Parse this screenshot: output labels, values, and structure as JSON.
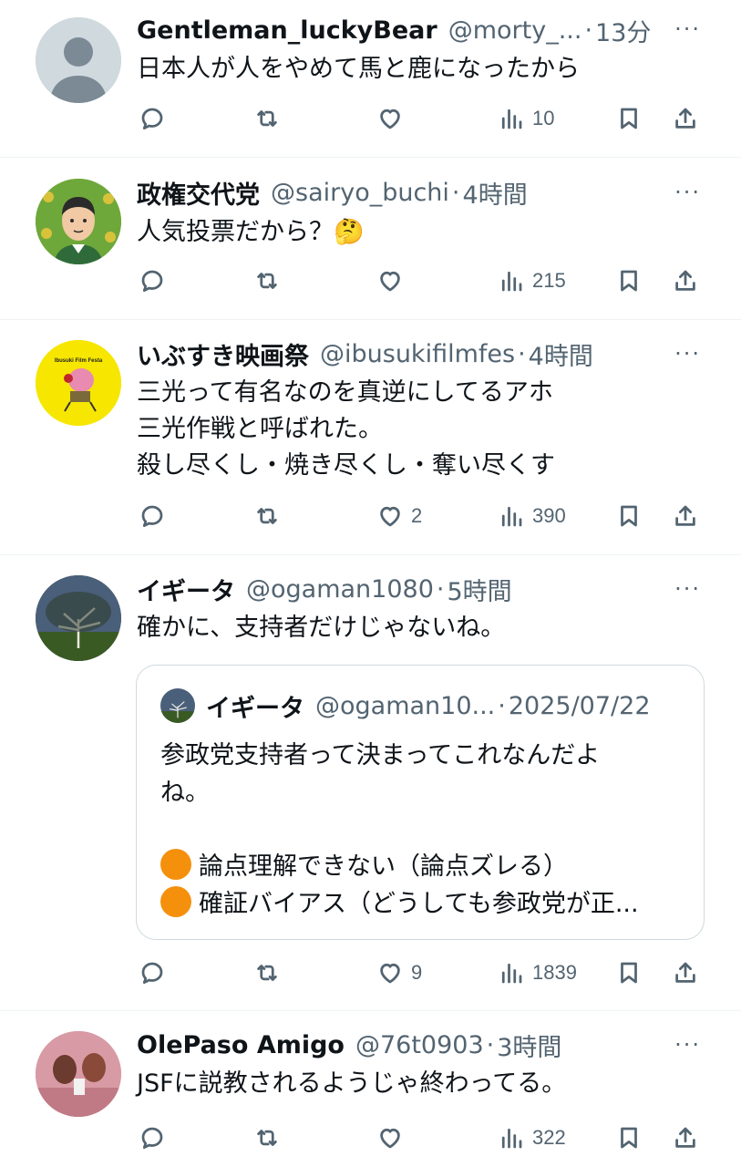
{
  "colors": {
    "text": "#0f1419",
    "secondary": "#536471",
    "divider": "#eff3f4",
    "quote_border": "#cfd9de",
    "orange_circle": "#f5900d"
  },
  "icons": {
    "reply": "reply-icon",
    "retweet": "retweet-icon",
    "like": "heart-icon",
    "views": "views-icon",
    "bookmark": "bookmark-icon",
    "share": "share-icon",
    "more": "more-icon"
  },
  "tweets": [
    {
      "name": "Gentleman_luckyBear",
      "handle": "@morty_...",
      "dot": "·",
      "time": "13分",
      "more": "···",
      "text": "日本人が人をやめて馬と鹿になったから",
      "likes": "",
      "views": "10"
    },
    {
      "name": "政権交代党",
      "handle": "@sairyo_buchi",
      "dot": "·",
      "time": "4時間",
      "more": "···",
      "text": "人気投票だから？🤔",
      "likes": "",
      "views": "215"
    },
    {
      "name": "いぶすき映画祭",
      "handle": "@ibusukifilmfes",
      "dot": "·",
      "time": "4時間",
      "more": "···",
      "text": "三光って有名なのを真逆にしてるアホ\n三光作戦と呼ばれた。\n殺し尽くし・焼き尽くし・奪い尽くす",
      "likes": "2",
      "views": "390",
      "avatar_text": "Ibusuki Film Festa"
    },
    {
      "name": "イギータ",
      "handle": "@ogaman1080",
      "dot": "·",
      "time": "5時間",
      "more": "···",
      "text": "確かに、支持者だけじゃないね。",
      "likes": "9",
      "views": "1839",
      "quote": {
        "name": "イギータ",
        "handle": "@ogaman10...",
        "dot": "·",
        "date": "2025/07/22",
        "text": "参政党支持者って決まってこれなんだよ\nね。",
        "line1": "論点理解できない（論点ズレる）",
        "line2": "確証バイアス（どうしても参政党が正..."
      }
    },
    {
      "name": "OlePaso Amigo",
      "handle": "@76t0903",
      "dot": "·",
      "time": "3時間",
      "more": "···",
      "text": "JSFに説教されるようじゃ終わってる。",
      "likes": "",
      "views": "322"
    }
  ]
}
